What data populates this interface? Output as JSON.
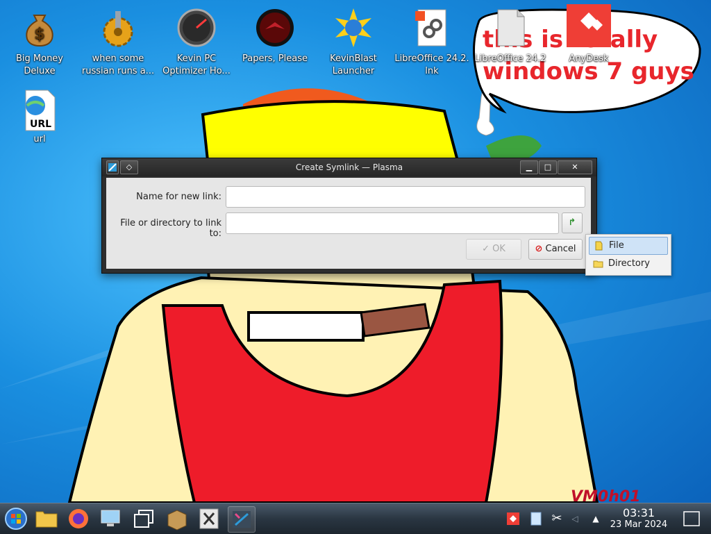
{
  "desktop": {
    "icons": [
      {
        "label": "Big Money Deluxe"
      },
      {
        "label": "when some russian runs a..."
      },
      {
        "label": "Kevin PC Optimizer Ho..."
      },
      {
        "label": "Papers, Please"
      },
      {
        "label": "KevinBlast Launcher"
      },
      {
        "label": "LibreOffice 24.2. lnk"
      },
      {
        "label": "LibreOffice 24.2"
      },
      {
        "label": "AnyDesk"
      },
      {
        "label": "url"
      }
    ],
    "url_icon_text": "URL",
    "speech_bubble_text": "this is totally windows 7 guys",
    "watermark": "VM0h01"
  },
  "dialog": {
    "title": "Create Symlink — Plasma",
    "name_label": "Name for new link:",
    "name_value": "",
    "target_label": "File or directory to link to:",
    "target_value": "",
    "ok_label": "OK",
    "cancel_label": "Cancel"
  },
  "popup_menu": {
    "items": [
      {
        "label": "File",
        "selected": true
      },
      {
        "label": "Directory",
        "selected": false
      }
    ]
  },
  "taskbar": {
    "time": "03:31",
    "date": "23 Mar 2024"
  },
  "colors": {
    "bubble_text": "#e8262c",
    "accent": "#2d9bd9"
  }
}
